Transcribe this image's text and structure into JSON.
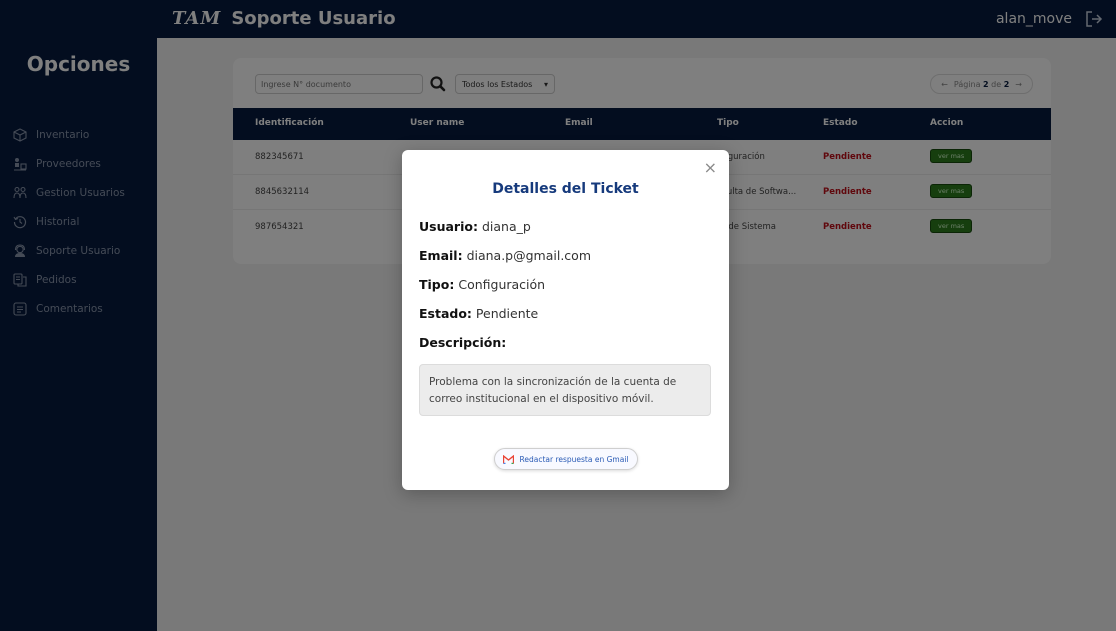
{
  "header": {
    "logo_text": "TAM",
    "title": "Soporte Usuario",
    "username": "alan_move"
  },
  "sidebar": {
    "title": "Opciones",
    "items": [
      {
        "label": "Inventario",
        "icon": "box-icon"
      },
      {
        "label": "Proveedores",
        "icon": "supplier-icon"
      },
      {
        "label": "Gestion Usuarios",
        "icon": "users-icon"
      },
      {
        "label": "Historial",
        "icon": "history-icon"
      },
      {
        "label": "Soporte Usuario",
        "icon": "support-icon"
      },
      {
        "label": "Pedidos",
        "icon": "orders-icon"
      },
      {
        "label": "Comentarios",
        "icon": "comments-icon"
      }
    ]
  },
  "toolbar": {
    "search_placeholder": "Ingrese N° documento",
    "status_filter": "Todos los Estados",
    "pager_prefix": "Página",
    "pager_current": "2",
    "pager_of": "de",
    "pager_total": "2"
  },
  "table": {
    "columns": [
      "Identificación",
      "User name",
      "Email",
      "Tipo",
      "Estado",
      "Accion"
    ],
    "rows": [
      {
        "id": "882345671",
        "tipo": "nfiguración",
        "estado": "Pendiente",
        "accion": "ver mas"
      },
      {
        "id": "8845632114",
        "tipo": "nsulta de Softwa...",
        "estado": "Pendiente",
        "accion": "ver mas"
      },
      {
        "id": "987654321",
        "tipo": "or de Sistema",
        "estado": "Pendiente",
        "accion": "ver mas"
      }
    ]
  },
  "modal": {
    "title": "Detalles del Ticket",
    "user_label": "Usuario:",
    "user_value": "diana_p",
    "email_label": "Email:",
    "email_value": "diana.p@gmail.com",
    "tipo_label": "Tipo:",
    "tipo_value": "Configuración",
    "estado_label": "Estado:",
    "estado_value": "Pendiente",
    "desc_label": "Descripción:",
    "description": "Problema con la sincronización de la cuenta de correo institucional en el dispositivo móvil.",
    "gmail_button": "Redactar respuesta en Gmail",
    "close_symbol": "×"
  },
  "colors": {
    "navy": "#061b3e",
    "pending_red": "#c0101a",
    "action_green": "#2d7d1d",
    "title_blue": "#163a7c"
  }
}
